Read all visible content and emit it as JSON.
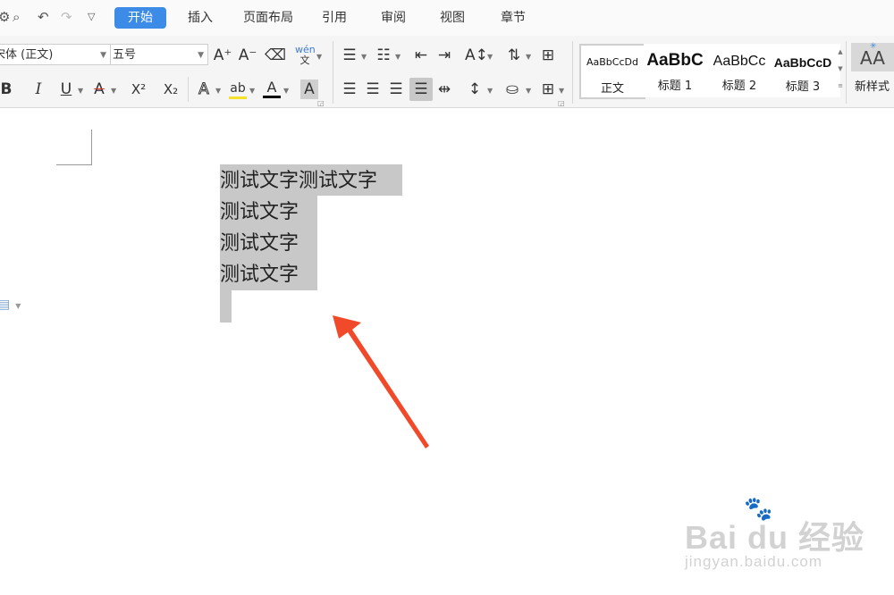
{
  "quick_access": {
    "icons": [
      "gear-icon",
      "print-preview-icon",
      "undo-icon",
      "redo-icon",
      "customize-chevron-icon"
    ]
  },
  "tabs": [
    {
      "label": "开始",
      "active": true
    },
    {
      "label": "插入"
    },
    {
      "label": "页面布局"
    },
    {
      "label": "引用"
    },
    {
      "label": "审阅"
    },
    {
      "label": "视图"
    },
    {
      "label": "章节"
    }
  ],
  "ribbon": {
    "font_name": "宋体 (正文)",
    "font_size": "五号",
    "grow_font": "A⁺",
    "shrink_font": "A⁻",
    "pinyin": "wén文",
    "bold": "B",
    "italic": "I",
    "underline": "U",
    "strikethrough": "A",
    "superscript": "X²",
    "subscript": "X₂",
    "text_effect": "A",
    "highlight": "ab",
    "font_color": "A",
    "char_shading": "A",
    "highlight_color": "#f5e12a",
    "font_color_value": "#000000"
  },
  "styles": [
    {
      "preview": "AaBbCcDd",
      "label": "正文",
      "selected": true
    },
    {
      "preview": "AaBbC",
      "label": "标题 1"
    },
    {
      "preview": "AaBbCc",
      "label": "标题 2"
    },
    {
      "preview": "AaBbCcD",
      "label": "标题 3"
    }
  ],
  "new_style": {
    "label": "新样式"
  },
  "document": {
    "lines": [
      "测试文字测试文字",
      "测试文字",
      "测试文字",
      "测试文字"
    ],
    "selection_color": "#c8c8c8"
  },
  "annotation": {
    "arrow_color": "#f04a2a"
  },
  "watermark": {
    "brand": "Bai du 经验",
    "url": "jingyan.baidu.com"
  }
}
